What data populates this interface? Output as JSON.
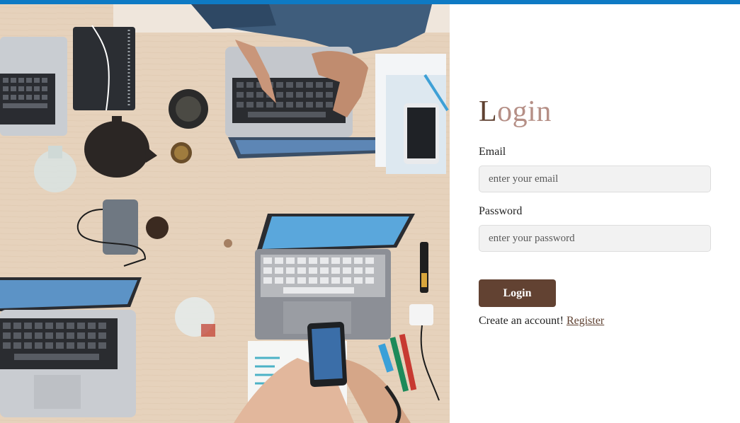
{
  "image": {
    "description": "overhead photo of a wooden desk with laptops, phones, notebooks and people typing"
  },
  "login": {
    "title_first": "L",
    "title_rest": "ogin",
    "email_label": "Email",
    "email_placeholder": "enter your email",
    "password_label": "Password",
    "password_placeholder": "enter your password",
    "submit_label": "Login",
    "register_prompt": "Create an account!",
    "register_link": "Register"
  },
  "colors": {
    "accent_bar": "#0e7ac4",
    "button": "#624232",
    "title_first": "#5f4131",
    "title_rest": "#b58f86"
  }
}
